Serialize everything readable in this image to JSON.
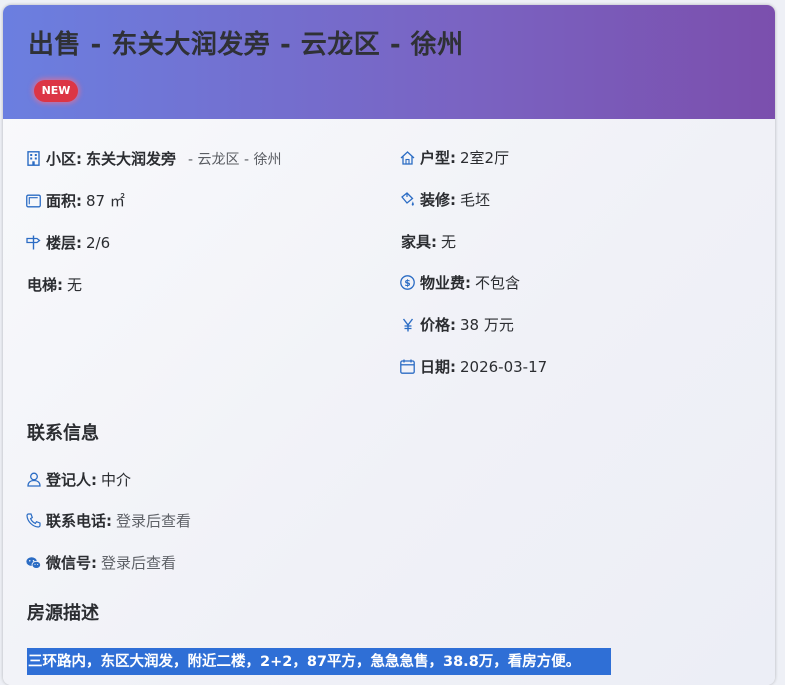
{
  "listing": {
    "title": "出售 - 东关大润发旁 - 云龙区 - 徐州",
    "badge": "NEW"
  },
  "details_left": {
    "community_label": "小区:",
    "community_value": "东关大润发旁",
    "community_location": "- 云龙区 - 徐州",
    "area_label": "面积:",
    "area_value": "87 ㎡",
    "floor_label": "楼层:",
    "floor_value": "2/6",
    "elevator_label": "电梯:",
    "elevator_value": "无"
  },
  "details_right": {
    "layout_label": "户型:",
    "layout_value": "2室2厅",
    "decoration_label": "装修:",
    "decoration_value": "毛坯",
    "furniture_label": "家具:",
    "furniture_value": "无",
    "property_fee_label": "物业费:",
    "property_fee_value": "不包含",
    "price_label": "价格:",
    "price_value": "38 万元",
    "date_label": "日期:",
    "date_value": "2026-03-17"
  },
  "contact": {
    "section_title": "联系信息",
    "registrant_label": "登记人:",
    "registrant_value": "中介",
    "phone_label": "联系电话:",
    "phone_value": "登录后查看",
    "wechat_label": "微信号:",
    "wechat_value": "登录后查看"
  },
  "description": {
    "section_title": "房源描述",
    "text": "三环路内，东区大润发，附近二楼，2+2，87平方，急急急售，38.8万，看房方便。"
  },
  "icons": {
    "building": "building-icon",
    "area": "area-icon",
    "floor": "floor-icon",
    "house": "house-icon",
    "paint": "paint-icon",
    "coin": "coin-icon",
    "yen": "yen-icon",
    "calendar": "calendar-icon",
    "person": "person-icon",
    "phone": "phone-icon",
    "wechat": "wechat-icon"
  },
  "colors": {
    "header_start": "#6b7fe0",
    "header_end": "#7b4fad",
    "badge": "#dc3545",
    "icon": "#2b6cc4",
    "selection": "#2f6fd6"
  }
}
